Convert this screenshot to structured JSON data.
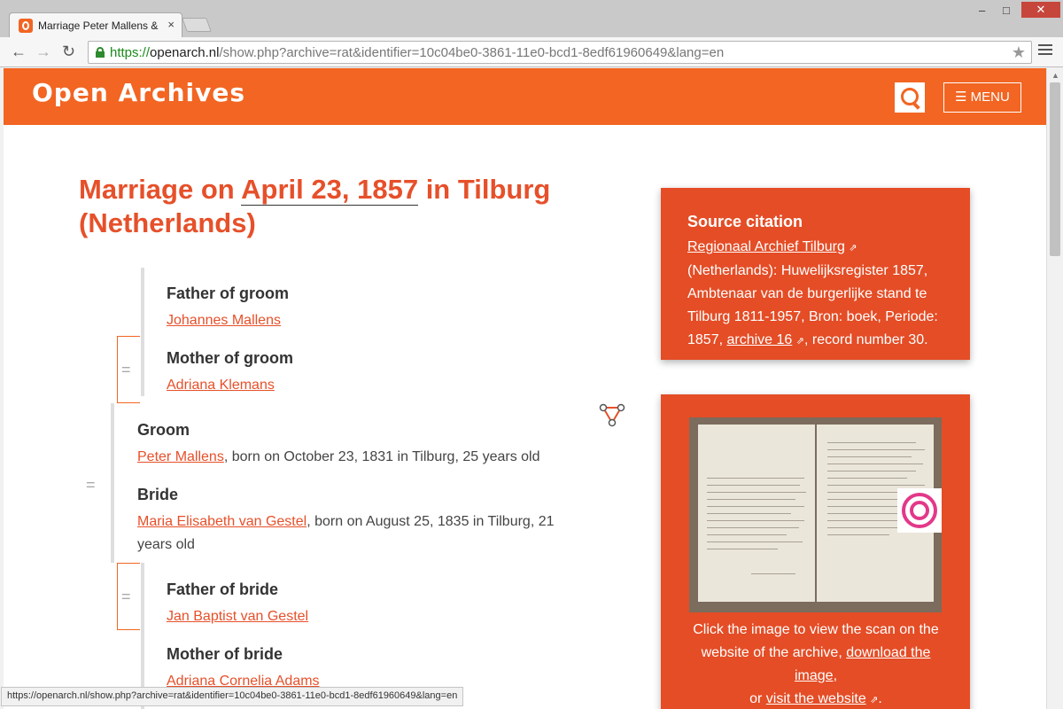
{
  "browser": {
    "tab_title": "Marriage Peter Mallens &",
    "tab_close": "×",
    "url_scheme": "https://",
    "url_host": "openarch.nl",
    "url_path": "/show.php?archive=rat&identifier=10c04be0-3861-11e0-bcd1-8edf61960649&lang=en",
    "status_url": "https://openarch.nl/show.php?archive=rat&identifier=10c04be0-3861-11e0-bcd1-8edf61960649&lang=en",
    "back": "←",
    "forward": "→",
    "reload": "↻",
    "star": "★",
    "minimize": "‒",
    "maximize": "□",
    "close": "✕"
  },
  "site": {
    "brand": "Open Archives",
    "menu_label": "☰ MENU"
  },
  "record": {
    "title_prefix": "Marriage on ",
    "title_date": "April 23, 1857",
    "title_suffix": " in Tilburg (Netherlands)",
    "father_groom_label": "Father of groom",
    "father_groom_name": "Johannes Mallens",
    "mother_groom_label": "Mother of groom",
    "mother_groom_name": "Adriana Klemans",
    "groom_label": "Groom",
    "groom_name": "Peter Mallens",
    "groom_details": ", born on October 23, 1831 in Tilburg, 25 years old",
    "bride_label": "Bride",
    "bride_name": "Maria Elisabeth van Gestel",
    "bride_details": ", born on August 25, 1835 in Tilburg, 21 years old",
    "father_bride_label": "Father of bride",
    "father_bride_name": "Jan Baptist van Gestel",
    "mother_bride_label": "Mother of bride",
    "mother_bride_name": "Adriana Cornelia Adams",
    "equals": "="
  },
  "citation": {
    "title": "Source citation",
    "archive_link": "Regionaal Archief Tilburg",
    "text_1": " (Netherlands): Huwelijksregister 1857, Ambtenaar van de burgerlijke stand te Tilburg 1811-1957, Bron: boek, Periode: 1857, ",
    "archive_number_link": "archive 16",
    "text_2": ", record number 30.",
    "ext_icon": "⇗"
  },
  "scan": {
    "caption_1": "Click the image to view the scan on the website of the archive, ",
    "download_link": "download the image",
    "caption_2": ",",
    "caption_3": "or ",
    "visit_link": "visit the website",
    "caption_4": "."
  }
}
